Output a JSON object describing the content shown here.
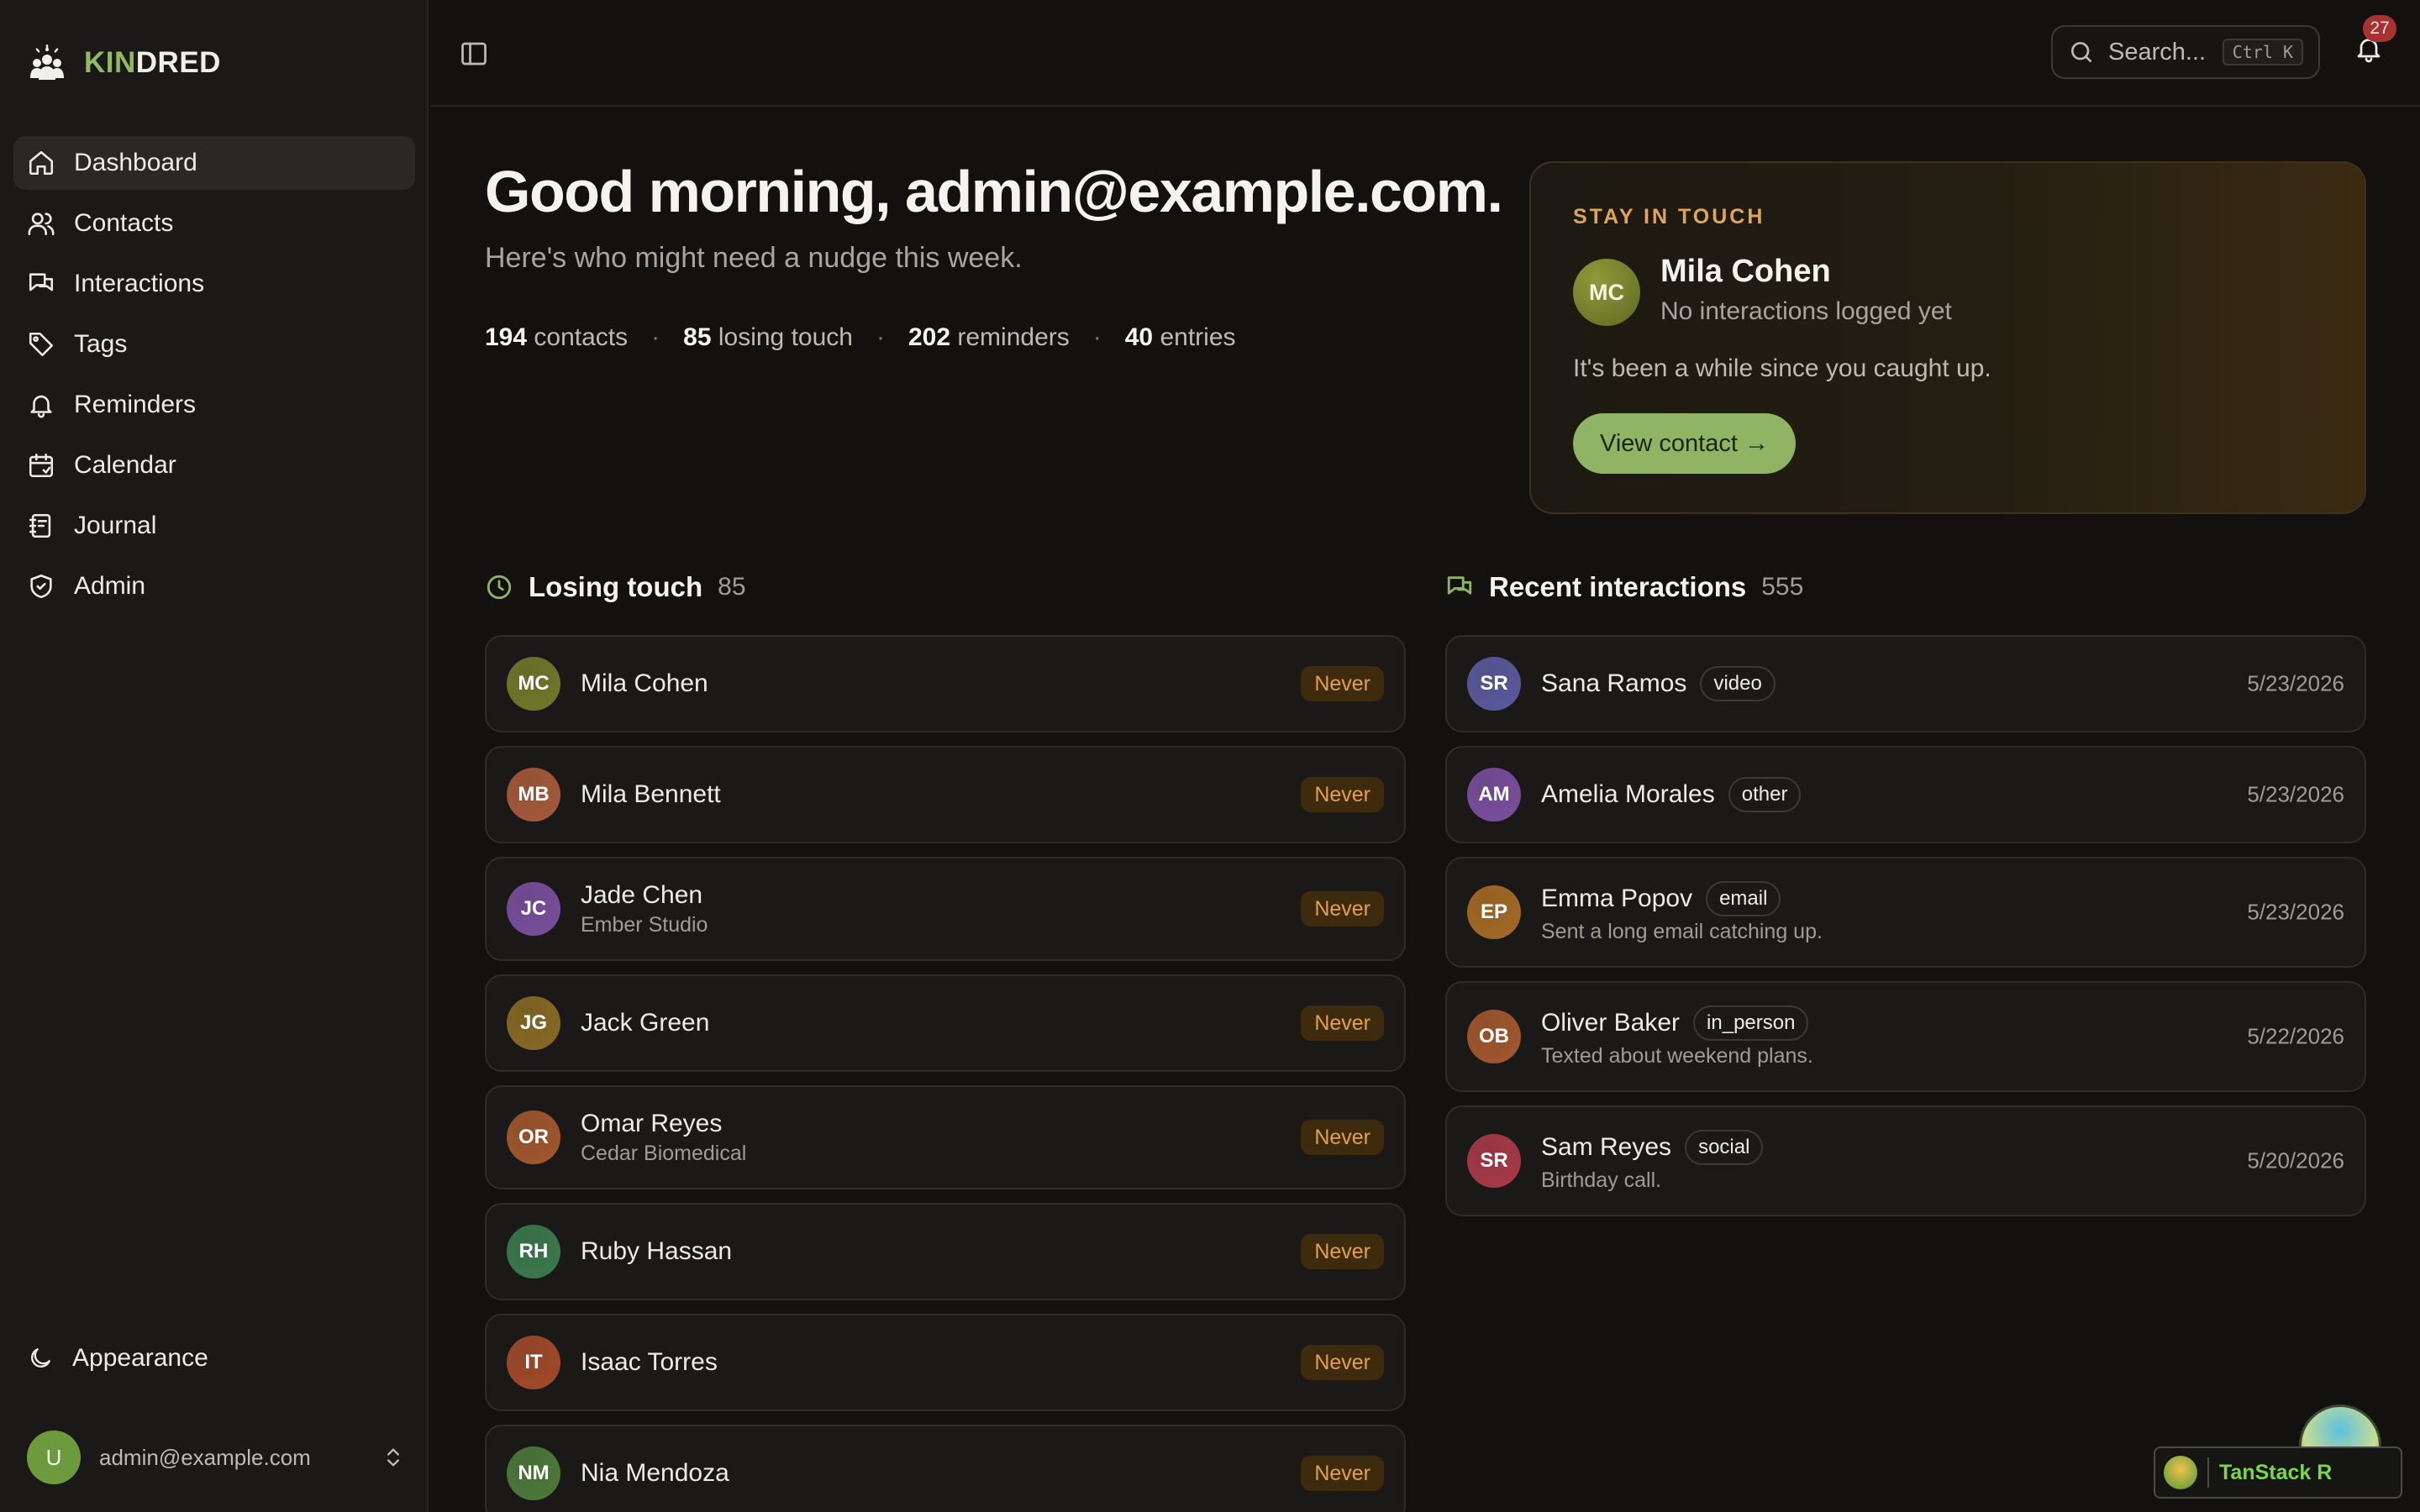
{
  "brand": {
    "kin": "KIN",
    "dred": "DRED"
  },
  "sidebar": {
    "items": [
      {
        "label": "Dashboard",
        "icon": "home-icon",
        "active": true
      },
      {
        "label": "Contacts",
        "icon": "users-icon"
      },
      {
        "label": "Interactions",
        "icon": "chat-icon"
      },
      {
        "label": "Tags",
        "icon": "tag-icon"
      },
      {
        "label": "Reminders",
        "icon": "bell-icon"
      },
      {
        "label": "Calendar",
        "icon": "calendar-icon"
      },
      {
        "label": "Journal",
        "icon": "journal-icon"
      },
      {
        "label": "Admin",
        "icon": "shield-icon"
      }
    ],
    "appearance": "Appearance",
    "user": {
      "initial": "U",
      "email": "admin@example.com"
    }
  },
  "topbar": {
    "search_placeholder": "Search...",
    "shortcut": "Ctrl K",
    "notification_count": "27"
  },
  "hero": {
    "greeting": "Good morning, admin@example.com.",
    "subtitle": "Here's who might need a nudge this week.",
    "stats": [
      {
        "value": "194",
        "label": "contacts"
      },
      {
        "value": "85",
        "label": "losing touch"
      },
      {
        "value": "202",
        "label": "reminders"
      },
      {
        "value": "40",
        "label": "entries"
      }
    ]
  },
  "stay_in_touch": {
    "label": "STAY IN TOUCH",
    "initials": "MC",
    "name": "Mila Cohen",
    "note": "No interactions logged yet",
    "message": "It's been a while since you caught up.",
    "button": "View contact →"
  },
  "losing_touch": {
    "title": "Losing touch",
    "count": "85",
    "items": [
      {
        "initials": "MC",
        "name": "Mila Cohen",
        "sub": "",
        "status": "Never",
        "color": "#6f7a2a"
      },
      {
        "initials": "MB",
        "name": "Mila Bennett",
        "sub": "",
        "status": "Never",
        "color": "#a65a3a"
      },
      {
        "initials": "JC",
        "name": "Jade Chen",
        "sub": "Ember Studio",
        "status": "Never",
        "color": "#7a4f9e"
      },
      {
        "initials": "JG",
        "name": "Jack Green",
        "sub": "",
        "status": "Never",
        "color": "#8a6a24"
      },
      {
        "initials": "OR",
        "name": "Omar Reyes",
        "sub": "Cedar Biomedical",
        "status": "Never",
        "color": "#a2582e"
      },
      {
        "initials": "RH",
        "name": "Ruby Hassan",
        "sub": "",
        "status": "Never",
        "color": "#3b7a4e"
      },
      {
        "initials": "IT",
        "name": "Isaac Torres",
        "sub": "",
        "status": "Never",
        "color": "#a34a2a"
      },
      {
        "initials": "NM",
        "name": "Nia Mendoza",
        "sub": "",
        "status": "Never",
        "color": "#4d7a3a"
      }
    ]
  },
  "recent_interactions": {
    "title": "Recent interactions",
    "count": "555",
    "items": [
      {
        "initials": "SR",
        "name": "Sana Ramos",
        "type": "video",
        "note": "",
        "date": "5/23/2026",
        "color": "#5a5a9e"
      },
      {
        "initials": "AM",
        "name": "Amelia Morales",
        "type": "other",
        "note": "",
        "date": "5/23/2026",
        "color": "#7a4f9e"
      },
      {
        "initials": "EP",
        "name": "Emma Popov",
        "type": "email",
        "note": "Sent a long email catching up.",
        "date": "5/23/2026",
        "color": "#a66a24"
      },
      {
        "initials": "OB",
        "name": "Oliver Baker",
        "type": "in_person",
        "note": "Texted about weekend plans.",
        "date": "5/22/2026",
        "color": "#a2582e"
      },
      {
        "initials": "SR",
        "name": "Sam Reyes",
        "type": "social",
        "note": "Birthday call.",
        "date": "5/20/2026",
        "color": "#a83a48"
      }
    ]
  },
  "devtools": {
    "label": "TanStack R"
  },
  "colors": {
    "accent": "#8fb464",
    "warning": "#e2a14a",
    "badge": "#a63232"
  }
}
